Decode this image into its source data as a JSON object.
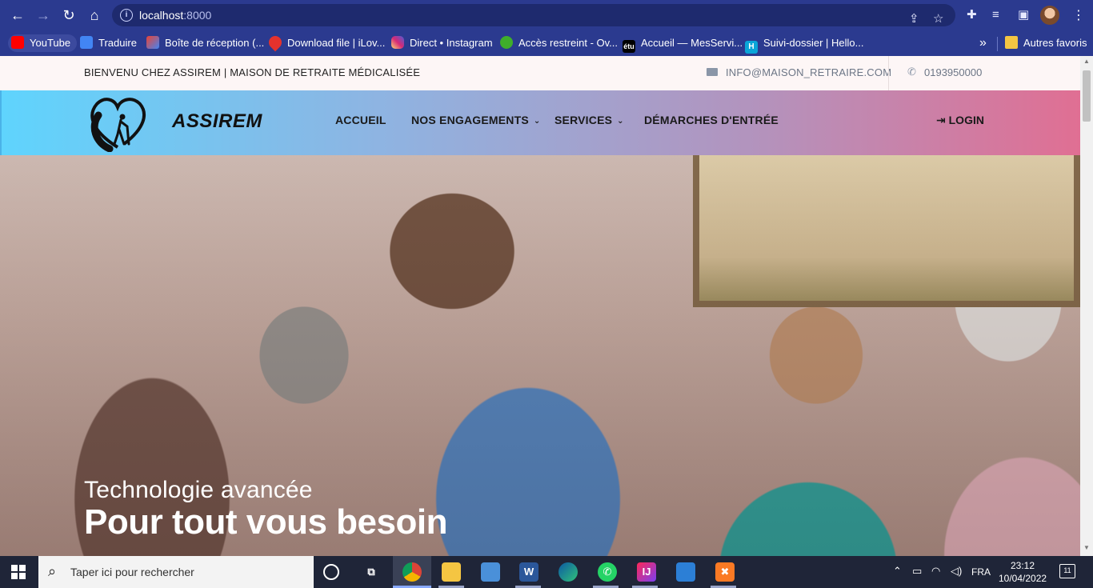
{
  "browser": {
    "url_host": "localhost",
    "url_port": ":8000",
    "bookmarks": [
      {
        "label": "YouTube",
        "color": "#ff0000"
      },
      {
        "label": "Traduire",
        "color": "#4285f4"
      },
      {
        "label": "Boîte de réception (...",
        "color": "#ea4335"
      },
      {
        "label": "Download file | iLov...",
        "color": "#e5322d"
      },
      {
        "label": "Direct • Instagram",
        "color": "#d62976"
      },
      {
        "label": "Accès restreint - Ov...",
        "color": "#3fae2a"
      },
      {
        "label": "Accueil — MesServi...",
        "color": "#000000"
      },
      {
        "label": "Suivi-dossier | Hello...",
        "color": "#0aa5d8"
      }
    ],
    "bookmark_fav_text": [
      "",
      "",
      "",
      "",
      "",
      "",
      "étu",
      "H"
    ],
    "other_bookmarks": "Autres favoris"
  },
  "topbar": {
    "welcome": "BIENVENU CHEZ ASSIREM | MAISON DE RETRAITE MÉDICALISÉE",
    "email": "INFO@MAISON_RETRAIRE.COM",
    "phone": "0193950000"
  },
  "navbar": {
    "brand": "ASSIREM",
    "items": [
      {
        "label": "ACCUEIL",
        "dropdown": false
      },
      {
        "label": "NOS ENGAGEMENTS",
        "dropdown": true
      },
      {
        "label": "SERVICES",
        "dropdown": true
      },
      {
        "label": "DÉMARCHES D'ENTRÉE",
        "dropdown": false
      }
    ],
    "login": "LOGIN"
  },
  "hero": {
    "subtitle": "Technologie avancée",
    "title": "Pour tout vous besoin"
  },
  "taskbar": {
    "search_placeholder": "Taper ici pour rechercher",
    "language": "FRA",
    "time": "23:12",
    "date": "10/04/2022",
    "notifications": "11"
  },
  "colors": {
    "chrome": "#2b3a8f",
    "nav_gradient_start": "#5fd4fd",
    "nav_gradient_end": "#e06f93"
  }
}
